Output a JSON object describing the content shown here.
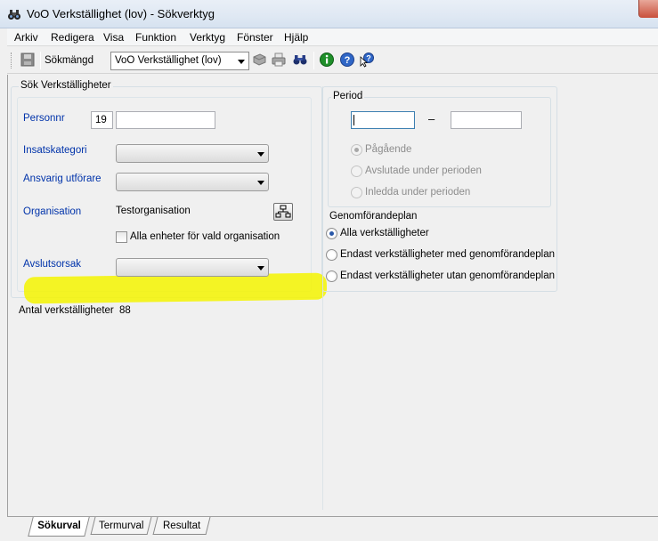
{
  "window": {
    "title": "VoO Verkställighet (lov) - Sökverktyg"
  },
  "menu": [
    "Arkiv",
    "Redigera",
    "Visa",
    "Funktion",
    "Verktyg",
    "Fönster",
    "Hjälp"
  ],
  "toolbar": {
    "search_set_label": "Sökmängd",
    "search_set_value": "VoO Verkställighet (lov)"
  },
  "search": {
    "group_label": "Sök Verkställigheter",
    "personnr_label": "Personnr",
    "personnr_prefix": "19",
    "personnr_value": "",
    "insatskategori_label": "Insatskategori",
    "insatskategori_value": "",
    "ansvarig_label": "Ansvarig utförare",
    "ansvarig_value": "",
    "organisation_label": "Organisation",
    "organisation_value": "Testorganisation",
    "all_units_label": "Alla enheter för vald organisation",
    "avslutsorsak_label": "Avslutsorsak",
    "avslutsorsak_value": "",
    "count_label": "Antal verkställigheter",
    "count_value": "88"
  },
  "period": {
    "group_label": "Period",
    "from_value": "",
    "dash": "–",
    "to_value": "",
    "options": [
      "Pågående",
      "Avslutade under perioden",
      "Inledda under perioden"
    ],
    "selected": 0
  },
  "plan": {
    "group_label": "Genomförandeplan",
    "options": [
      "Alla verkställigheter",
      "Endast verkställigheter med genomförandeplan",
      "Endast verkställigheter utan genomförandeplan"
    ],
    "selected": 0
  },
  "tabs": [
    "Sökurval",
    "Termurval",
    "Resultat"
  ],
  "active_tab": 0,
  "colors": {
    "highlight": "#f4f400",
    "link_label": "#0033aa",
    "radio_selected": "#2a58a8"
  },
  "icons": [
    "binoculars-icon",
    "save-icon",
    "print-preview-icon",
    "print-icon",
    "find-icon",
    "info-icon",
    "help-icon",
    "context-help-icon",
    "org-tree-icon"
  ]
}
